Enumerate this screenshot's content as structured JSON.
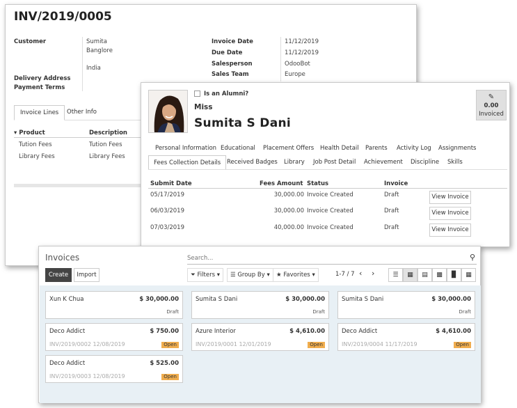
{
  "invoice_form": {
    "title": "INV/2019/0005",
    "customer_label": "Customer",
    "customer_lines": [
      "Sumita",
      "Banglore",
      "India"
    ],
    "delivery_address_label": "Delivery Address",
    "payment_terms_label": "Payment Terms",
    "invoice_date_label": "Invoice Date",
    "invoice_date": "11/12/2019",
    "due_date_label": "Due Date",
    "due_date": "11/12/2019",
    "salesperson_label": "Salesperson",
    "salesperson": "OdooBot",
    "sales_team_label": "Sales Team",
    "sales_team": "Europe",
    "tabs": [
      "Invoice Lines",
      "Other Info"
    ],
    "columns": [
      "Product",
      "Description"
    ],
    "rows": [
      [
        "Tution Fees",
        "Tution Fees"
      ],
      [
        "Library Fees",
        "Library Fees"
      ]
    ]
  },
  "student": {
    "alumni_label": "Is an Alumni?",
    "title": "Miss",
    "first_name": "Sumita",
    "middle_name": "S",
    "last_name": "Dani",
    "invoiced_amount": "0.00",
    "invoiced_label": "Invoiced",
    "tabs_row1": [
      "Personal Information",
      "Educational",
      "Placement Offers",
      "Health Detail",
      "Parents",
      "Activity Log",
      "Assignments"
    ],
    "tabs_row2": [
      "Fees Collection Details",
      "Received Badges",
      "Library",
      "Job Post Detail",
      "Achievement",
      "Discipline",
      "Skills"
    ],
    "fees_columns": [
      "Submit Date",
      "Fees Amount",
      "Status",
      "Invoice"
    ],
    "fees_rows": [
      {
        "date": "05/17/2019",
        "amount": "30,000.00",
        "status": "Invoice Created",
        "invoice": "Draft",
        "button": "View Invoice"
      },
      {
        "date": "06/03/2019",
        "amount": "30,000.00",
        "status": "Invoice Created",
        "invoice": "Draft",
        "button": "View Invoice"
      },
      {
        "date": "07/03/2019",
        "amount": "40,000.00",
        "status": "Invoice Created",
        "invoice": "Draft",
        "button": "View Invoice"
      }
    ]
  },
  "kanban": {
    "title": "Invoices",
    "search_placeholder": "Search...",
    "create_label": "Create",
    "import_label": "Import",
    "filters_label": "Filters",
    "group_by_label": "Group By",
    "favorites_label": "Favorites",
    "pager": "1-7 / 7",
    "cards": [
      {
        "name": "Xun K Chua",
        "amount": "$ 30,000.00",
        "ref": "",
        "state": "Draft"
      },
      {
        "name": "Sumita S Dani",
        "amount": "$ 30,000.00",
        "ref": "",
        "state": "Draft"
      },
      {
        "name": "Sumita S Dani",
        "amount": "$ 30,000.00",
        "ref": "",
        "state": "Draft"
      },
      {
        "name": "Deco Addict",
        "amount": "$ 750.00",
        "ref": "INV/2019/0002 12/08/2019",
        "state": "Open"
      },
      {
        "name": "Azure Interior",
        "amount": "$ 4,610.00",
        "ref": "INV/2019/0001 12/01/2019",
        "state": "Open"
      },
      {
        "name": "Deco Addict",
        "amount": "$ 4,610.00",
        "ref": "INV/2019/0004 11/17/2019",
        "state": "Open"
      },
      {
        "name": "Deco Addict",
        "amount": "$ 525.00",
        "ref": "INV/2019/0003 12/08/2019",
        "state": "Open"
      }
    ]
  }
}
